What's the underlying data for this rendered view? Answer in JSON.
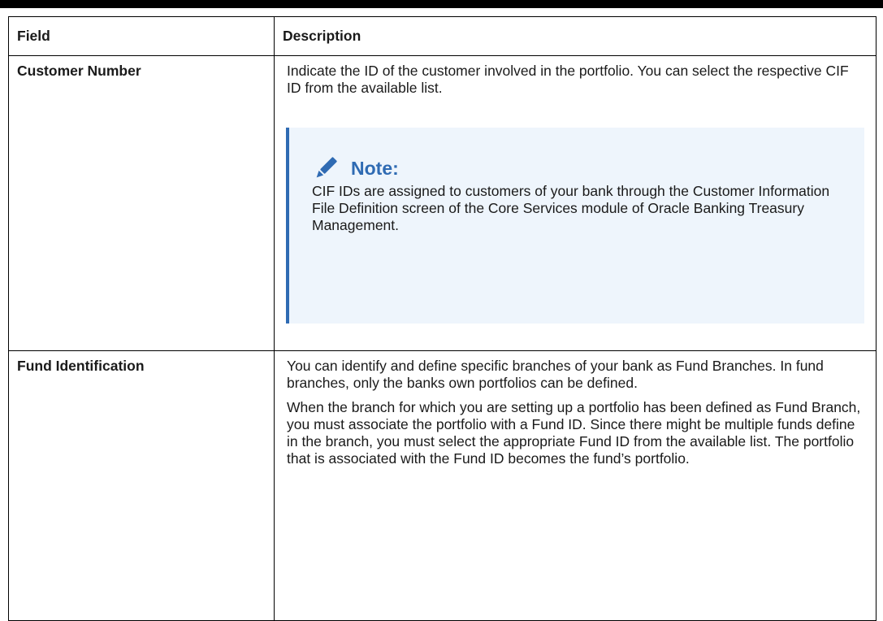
{
  "table": {
    "headers": {
      "field": "Field",
      "description": "Description"
    },
    "rows": [
      {
        "field": "Customer Number",
        "description": "Indicate the ID of the customer involved in the portfolio. You can select the respective CIF ID from the available list.",
        "note": {
          "icon": "pencil-icon",
          "title": "Note:",
          "text": "CIF IDs are assigned to customers of your bank through the Customer Information File Definition screen of the Core Services module of Oracle Banking Treasury Management."
        }
      },
      {
        "field": "Fund Identification",
        "paragraphs": [
          "You can identify and define specific branches of your bank as Fund Branches. In fund branches, only the banks own portfolios can be defined.",
          "When the branch for which you are setting up a portfolio has been defined as Fund Branch, you must associate the portfolio with a Fund ID. Since there might be multiple funds define in the branch, you must select the appropriate Fund ID from the available list. The portfolio that is associated with the Fund ID becomes the fund’s portfolio."
        ]
      }
    ]
  },
  "colors": {
    "note_accent": "#2f6bb3",
    "note_background": "#eef5fc",
    "border": "#000000"
  }
}
